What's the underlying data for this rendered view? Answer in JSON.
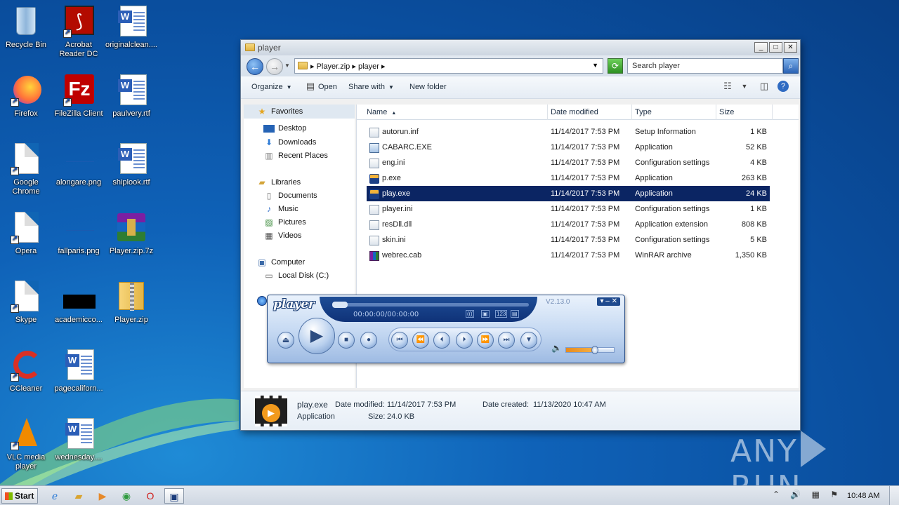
{
  "desktop": {
    "icons": [
      {
        "label": "Recycle Bin",
        "icon": "recycle-bin-icon"
      },
      {
        "label": "Acrobat Reader DC",
        "icon": "acrobat-icon"
      },
      {
        "label": "originalclean....",
        "icon": "word-doc-icon"
      },
      {
        "label": "Firefox",
        "icon": "firefox-icon"
      },
      {
        "label": "FileZilla Client",
        "icon": "filezilla-icon"
      },
      {
        "label": "paulvery.rtf",
        "icon": "word-doc-icon"
      },
      {
        "label": "Google Chrome",
        "icon": "blank-doc-icon"
      },
      {
        "label": "alongare.png",
        "icon": "image-icon"
      },
      {
        "label": "shiplook.rtf",
        "icon": "word-doc-icon"
      },
      {
        "label": "Opera",
        "icon": "blank-doc-icon"
      },
      {
        "label": "fallparis.png",
        "icon": "image-icon"
      },
      {
        "label": "Player.zip.7z",
        "icon": "winrar-icon"
      },
      {
        "label": "Skype",
        "icon": "blank-doc-icon"
      },
      {
        "label": "academicco...",
        "icon": "black-image-icon"
      },
      {
        "label": "Player.zip",
        "icon": "zip-folder-icon"
      },
      {
        "label": "CCleaner",
        "icon": "ccleaner-icon"
      },
      {
        "label": "pagecaliforn...",
        "icon": "word-doc-icon"
      },
      {
        "label": "VLC media player",
        "icon": "vlc-icon"
      },
      {
        "label": "wednesday....",
        "icon": "word-doc-icon"
      }
    ]
  },
  "explorer": {
    "title": "player",
    "window_buttons": {
      "minimize": "_",
      "maximize": "□",
      "close": "✕"
    },
    "address": {
      "crumb1": "Player.zip",
      "crumb2": "player",
      "sep": "▸"
    },
    "search_placeholder": "Search player",
    "toolbar": {
      "organize": "Organize",
      "open": "Open",
      "share_with": "Share with",
      "new_folder": "New folder"
    },
    "nav": {
      "favorites": "Favorites",
      "desktop": "Desktop",
      "downloads": "Downloads",
      "recent_places": "Recent Places",
      "libraries": "Libraries",
      "documents": "Documents",
      "music": "Music",
      "pictures": "Pictures",
      "videos": "Videos",
      "computer": "Computer",
      "local_disk": "Local Disk (C:)"
    },
    "columns": {
      "name": "Name",
      "date_modified": "Date modified",
      "type": "Type",
      "size": "Size"
    },
    "files": [
      {
        "name": "autorun.inf",
        "date": "11/14/2017 7:53 PM",
        "type": "Setup Information",
        "size": "1 KB",
        "icon": "settings-file-icon"
      },
      {
        "name": "CABARC.EXE",
        "date": "11/14/2017 7:53 PM",
        "type": "Application",
        "size": "52 KB",
        "icon": "exe-icon"
      },
      {
        "name": "eng.ini",
        "date": "11/14/2017 7:53 PM",
        "type": "Configuration settings",
        "size": "4 KB",
        "icon": "settings-file-icon"
      },
      {
        "name": "p.exe",
        "date": "11/14/2017 7:53 PM",
        "type": "Application",
        "size": "263 KB",
        "icon": "player-app-icon"
      },
      {
        "name": "play.exe",
        "date": "11/14/2017 7:53 PM",
        "type": "Application",
        "size": "24 KB",
        "icon": "player-app-icon"
      },
      {
        "name": "player.ini",
        "date": "11/14/2017 7:53 PM",
        "type": "Configuration settings",
        "size": "1 KB",
        "icon": "settings-file-icon"
      },
      {
        "name": "resDll.dll",
        "date": "11/14/2017 7:53 PM",
        "type": "Application extension",
        "size": "808 KB",
        "icon": "settings-file-icon"
      },
      {
        "name": "skin.ini",
        "date": "11/14/2017 7:53 PM",
        "type": "Configuration settings",
        "size": "5 KB",
        "icon": "settings-file-icon"
      },
      {
        "name": "webrec.cab",
        "date": "11/14/2017 7:53 PM",
        "type": "WinRAR archive",
        "size": "1,350 KB",
        "icon": "winrar-icon"
      }
    ],
    "details": {
      "name": "play.exe",
      "type": "Application",
      "modified_label": "Date modified:",
      "modified_value": "11/14/2017 7:53 PM",
      "created_label": "Date created:",
      "created_value": "11/13/2020 10:47 AM",
      "size_label": "Size:",
      "size_value": "24.0 KB"
    }
  },
  "player": {
    "logo": "player",
    "time": "00:00:00/00:00:00",
    "version": "V2.13.0",
    "mini_icons": [
      "(((",
      "▣",
      "123",
      "▤"
    ],
    "window_buttons": "▾  –  ✕",
    "buttons": {
      "play": "▶",
      "eject": "⏏",
      "stop": "■",
      "record": "●",
      "first": "⏮",
      "rewind": "⏪",
      "prev": "⏴",
      "next": "⏵",
      "forward": "⏩",
      "last": "⏭",
      "menu": "▼"
    },
    "volume_fraction": 0.6
  },
  "taskbar": {
    "start": "Start",
    "clock": "10:48 AM",
    "tray": "⌃ 🔊 ▦ ⚑"
  },
  "watermark": {
    "left": "ANY",
    "right": "RUN"
  },
  "colors": {
    "selection": "#0b2563",
    "accent": "#2565bd"
  }
}
